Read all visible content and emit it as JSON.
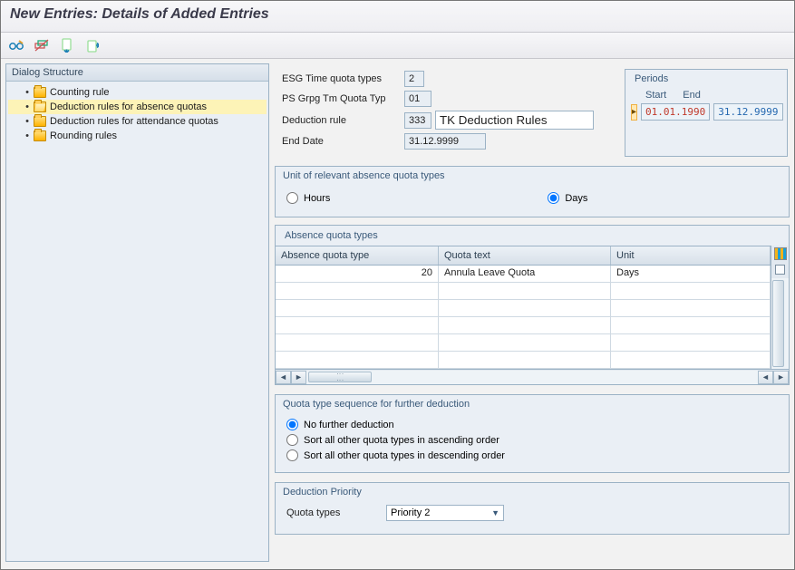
{
  "title": "New Entries: Details of Added Entries",
  "dialog_structure": {
    "header": "Dialog Structure",
    "items": [
      {
        "label": "Counting rule",
        "selected": false
      },
      {
        "label": "Deduction rules for absence quotas",
        "selected": true
      },
      {
        "label": "Deduction rules for attendance quotas",
        "selected": false
      },
      {
        "label": "Rounding rules",
        "selected": false
      }
    ]
  },
  "fields": {
    "esg_label": "ESG Time quota types",
    "esg_value": "2",
    "psg_label": "PS Grpg Tm Quota Typ",
    "psg_value": "01",
    "dedrule_label": "Deduction rule",
    "dedrule_code": "333",
    "dedrule_text": "TK Deduction Rules",
    "enddate_label": "End Date",
    "enddate_value": "31.12.9999"
  },
  "periods": {
    "title": "Periods",
    "start_label": "Start",
    "end_label": "End",
    "start_value": "01.01.1990",
    "end_value": "31.12.9999"
  },
  "unit_group": {
    "title": "Unit of relevant absence quota types",
    "hours": "Hours",
    "days": "Days",
    "selected": "days"
  },
  "absence_table": {
    "title": "Absence quota types",
    "columns": {
      "c1": "Absence quota type",
      "c2": "Quota text",
      "c3": "Unit"
    },
    "rows": [
      {
        "type": "20",
        "text": "Annula Leave Quota",
        "unit": "Days"
      },
      {
        "type": "",
        "text": "",
        "unit": ""
      },
      {
        "type": "",
        "text": "",
        "unit": ""
      },
      {
        "type": "",
        "text": "",
        "unit": ""
      },
      {
        "type": "",
        "text": "",
        "unit": ""
      },
      {
        "type": "",
        "text": "",
        "unit": ""
      }
    ]
  },
  "sequence_group": {
    "title": "Quota type sequence for further deduction",
    "opt1": "No further deduction",
    "opt2": "Sort all other quota types in ascending order",
    "opt3": "Sort all other quota types in descending order"
  },
  "priority_group": {
    "title": "Deduction Priority",
    "quota_types_label": "Quota types",
    "quota_types_value": "Priority 2"
  }
}
